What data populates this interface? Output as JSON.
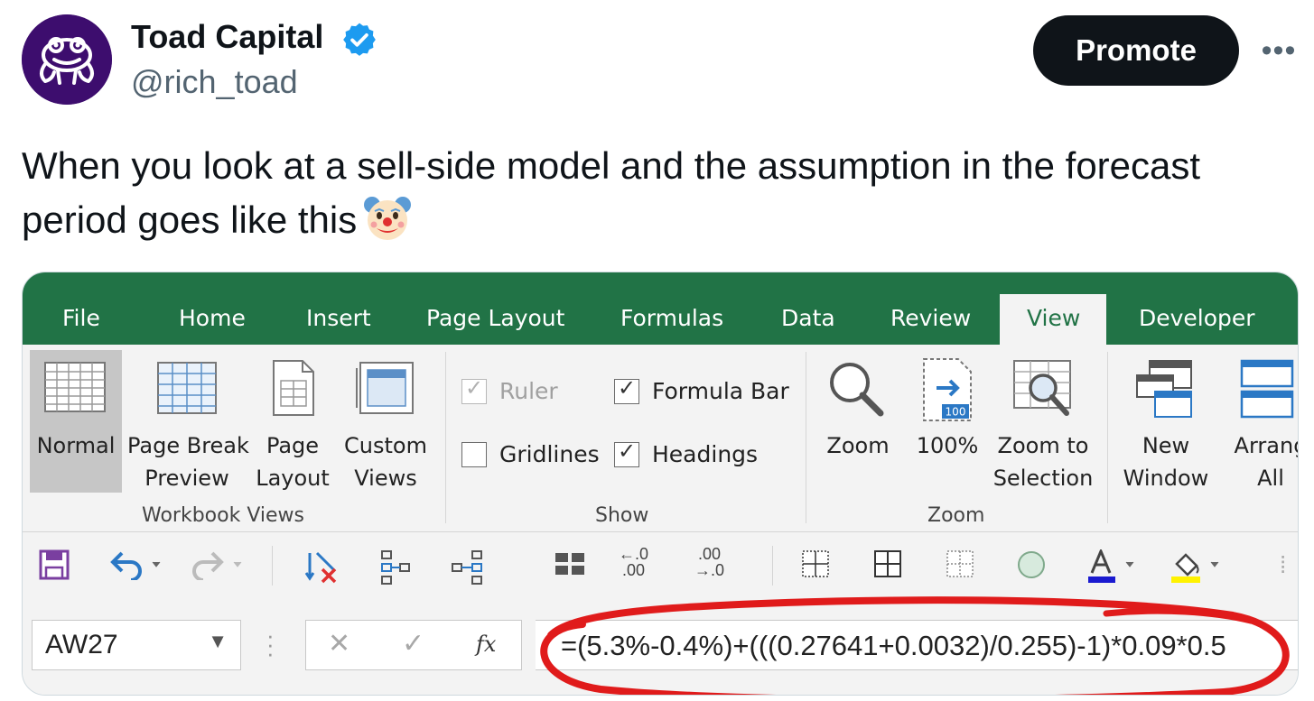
{
  "tweet": {
    "display_name": "Toad Capital",
    "handle": "@rich_toad",
    "promote_label": "Promote",
    "more_label": "•••",
    "text": "When you look at a sell-side model and the assumption in the forecast period goes like this",
    "emoji": "clown-face",
    "avatar_color": "#3d0d6e",
    "verified_color": "#1d9bf0"
  },
  "excel": {
    "accent_color": "#217346",
    "tabs": [
      "File",
      "Home",
      "Insert",
      "Page Layout",
      "Formulas",
      "Data",
      "Review",
      "View",
      "Developer"
    ],
    "active_tab": "View",
    "groups": {
      "workbook_views": {
        "label": "Workbook Views",
        "buttons": [
          {
            "line1": "Normal",
            "line2": ""
          },
          {
            "line1": "Page Break",
            "line2": "Preview"
          },
          {
            "line1": "Page",
            "line2": "Layout"
          },
          {
            "line1": "Custom",
            "line2": "Views"
          }
        ]
      },
      "show": {
        "label": "Show",
        "ruler": "Ruler",
        "formula_bar": "Formula Bar",
        "gridlines": "Gridlines",
        "headings": "Headings"
      },
      "zoom": {
        "label": "Zoom",
        "buttons": [
          {
            "line1": "Zoom",
            "line2": ""
          },
          {
            "line1": "100%",
            "line2": ""
          },
          {
            "line1": "Zoom to",
            "line2": "Selection"
          }
        ],
        "hundred_badge": "100"
      },
      "window": {
        "buttons": [
          {
            "line1": "New",
            "line2": "Window"
          },
          {
            "line1": "Arrang",
            "line2": "All"
          }
        ]
      }
    },
    "qat": {
      "increase_decimal": "←.0\n.00",
      "decrease_decimal": ".00\n→.0"
    },
    "name_box": "AW27",
    "fx_label": "fx",
    "formula": "=(5.3%-0.4%)+(((0.27641+0.0032)/0.255)-1)*0.09*0.5"
  }
}
